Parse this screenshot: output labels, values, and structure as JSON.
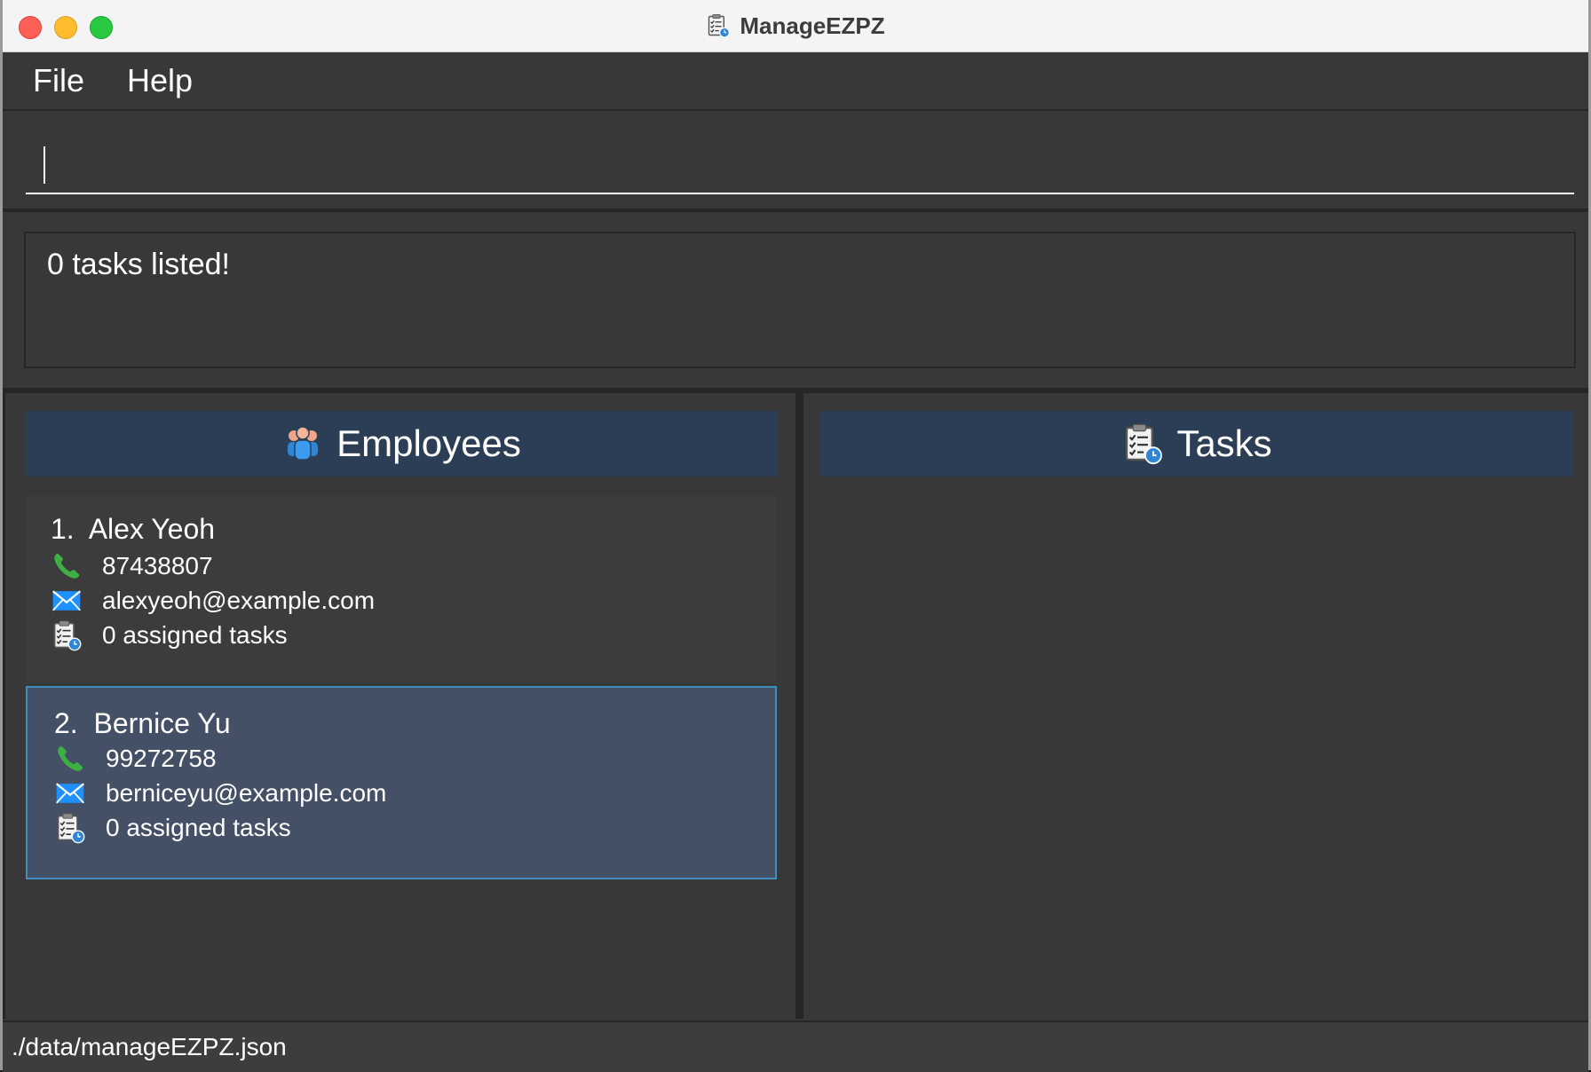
{
  "window": {
    "title": "ManageEZPZ",
    "traffic_lights": [
      "close",
      "minimize",
      "zoom"
    ]
  },
  "menu": {
    "items": [
      {
        "label": "File"
      },
      {
        "label": "Help"
      }
    ]
  },
  "command_box": {
    "value": "",
    "placeholder": ""
  },
  "result_display": {
    "text": "0 tasks listed!"
  },
  "employees_panel": {
    "title": "Employees",
    "icon": "people-icon",
    "employees": [
      {
        "index": "1.",
        "name": "Alex Yeoh",
        "phone": "87438807",
        "email": "alexyeoh@example.com",
        "tasks": "0 assigned tasks",
        "selected": false
      },
      {
        "index": "2.",
        "name": "Bernice Yu",
        "phone": "99272758",
        "email": "berniceyu@example.com",
        "tasks": "0 assigned tasks",
        "selected": true
      }
    ]
  },
  "tasks_panel": {
    "title": "Tasks",
    "icon": "task-clipboard-icon",
    "tasks": []
  },
  "status_bar": {
    "path": "./data/manageEZPZ.json"
  },
  "colors": {
    "background": "#383838",
    "panel_header": "#2c3e55",
    "selected_card": "#435066",
    "selected_border": "#3e8ec0",
    "phone_icon": "#3cb043",
    "email_icon": "#1e90ff"
  }
}
